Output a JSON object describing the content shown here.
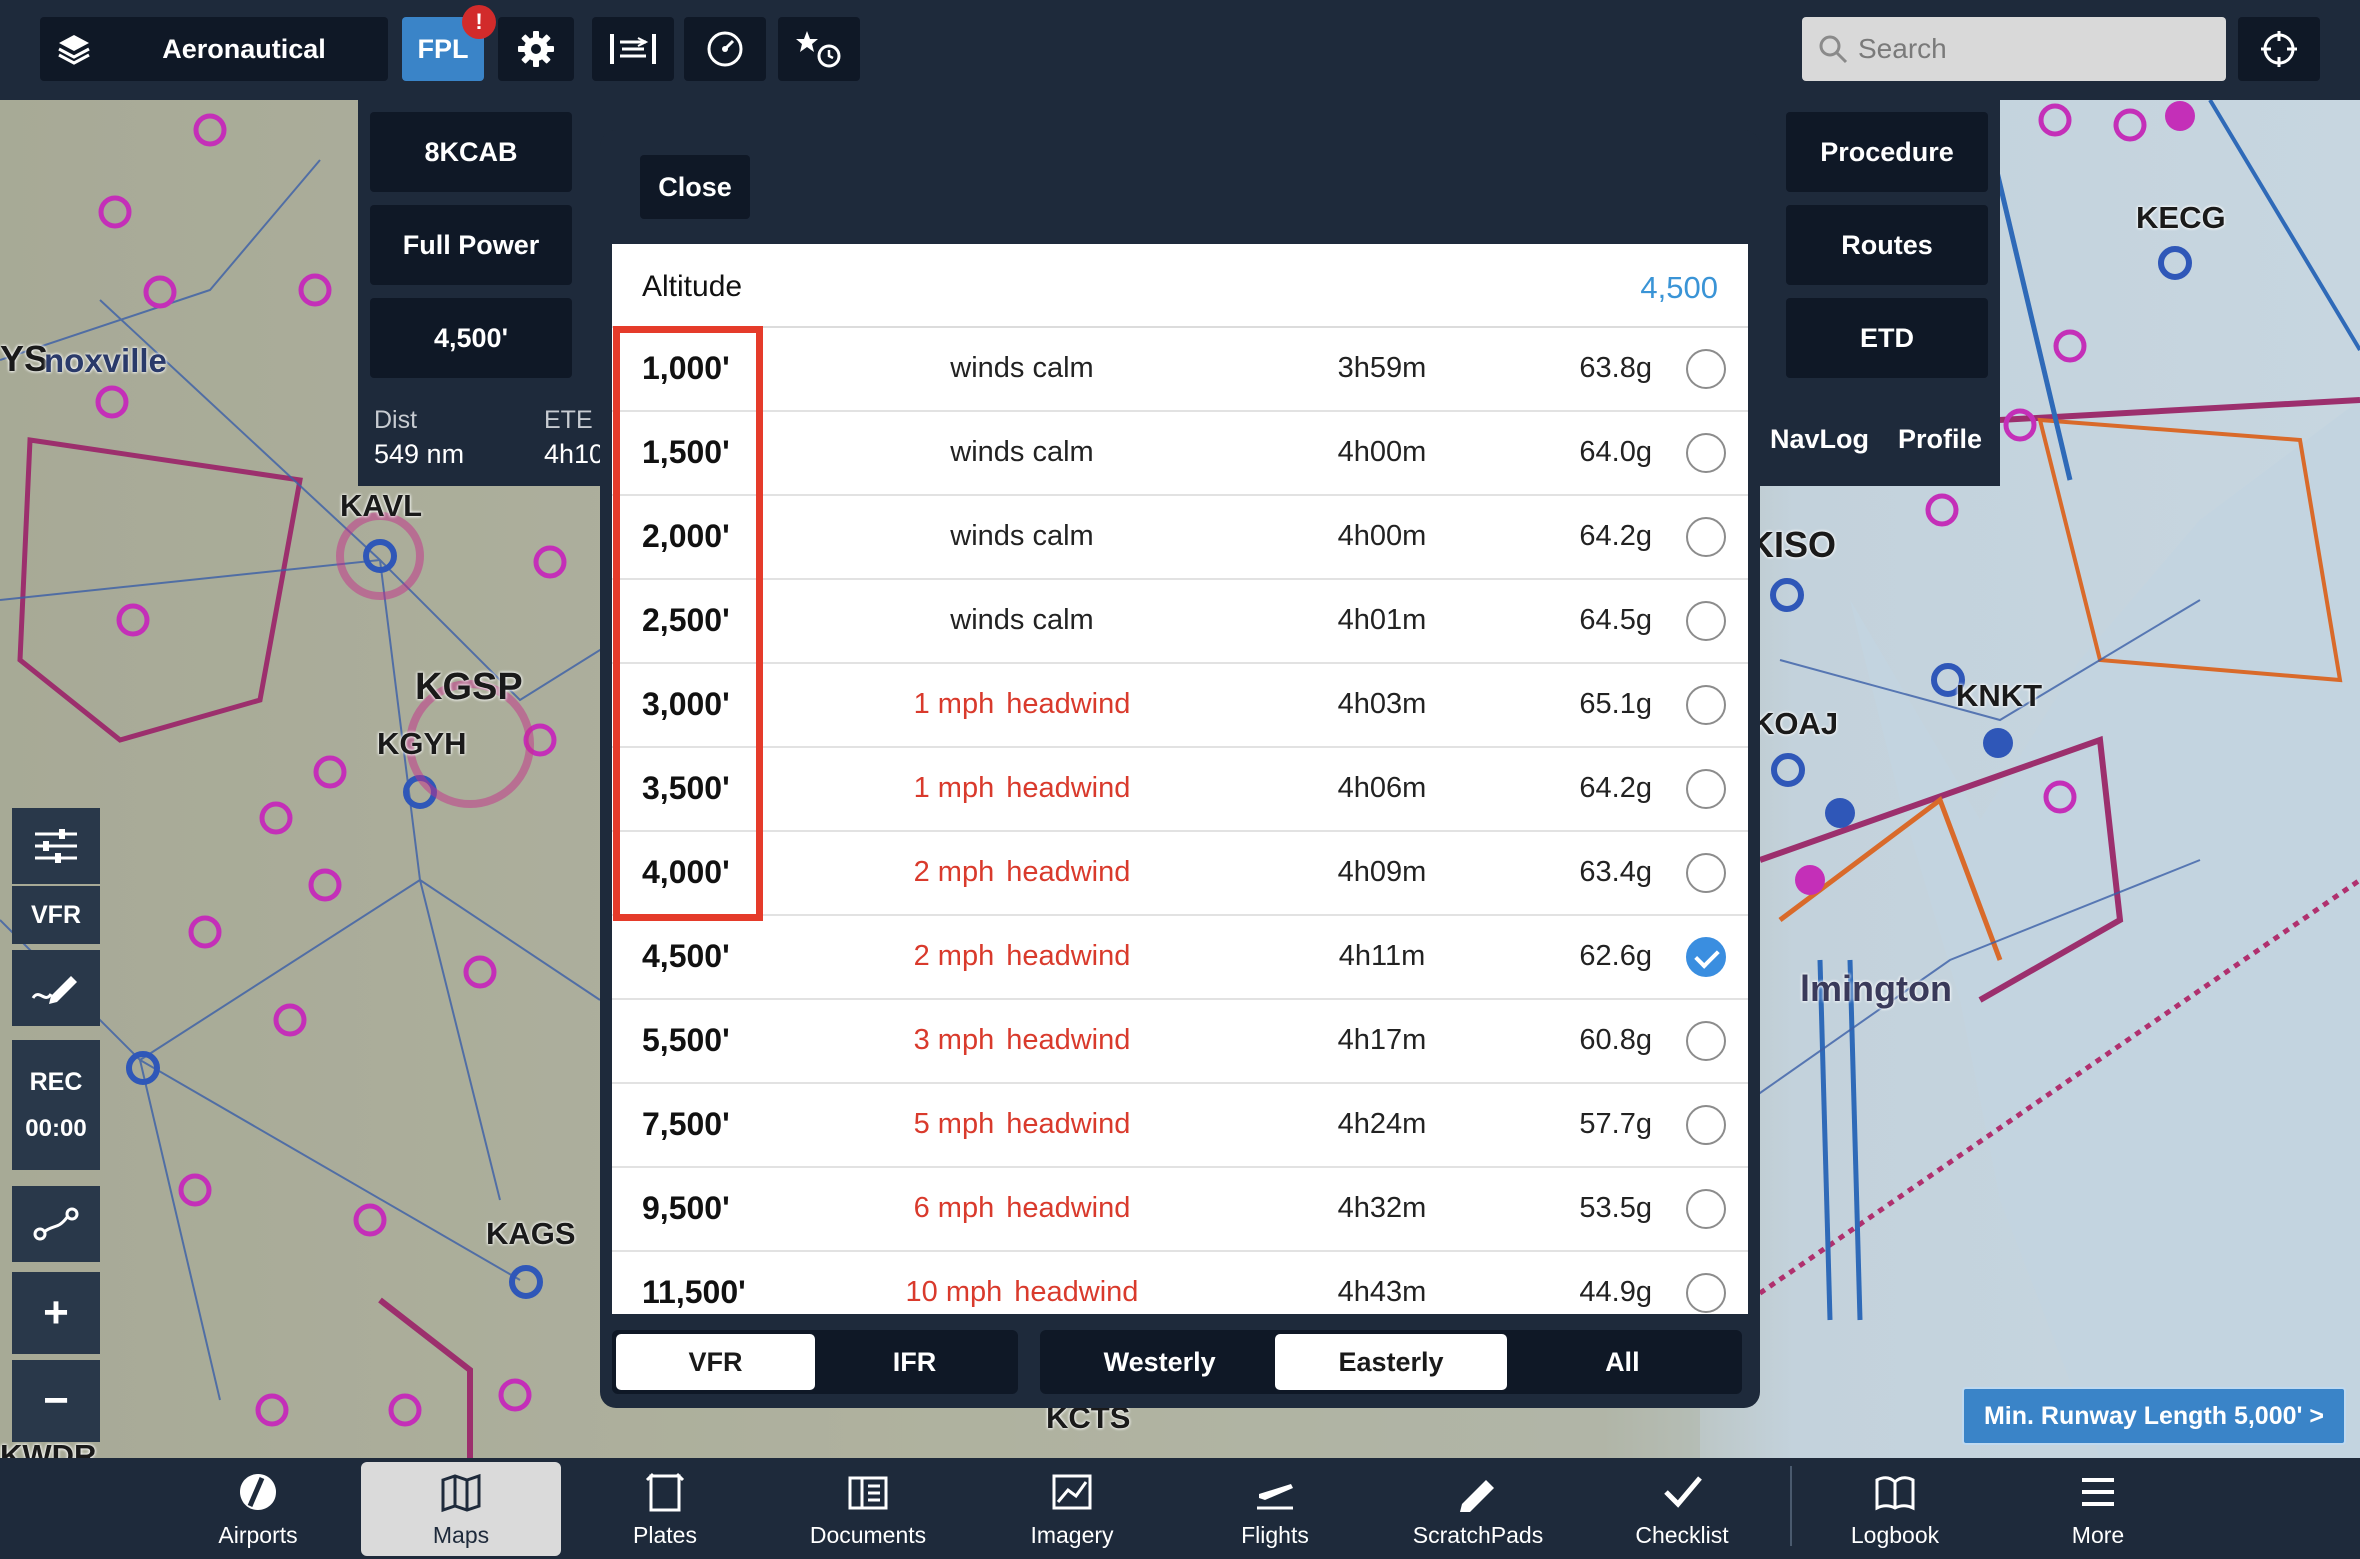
{
  "topbar": {
    "layer_label": "Aeronautical",
    "fpl_label": "FPL",
    "fpl_badge": "!",
    "search_placeholder": "Search"
  },
  "flight_plan": {
    "left_buttons": [
      "8KCAB",
      "Full Power",
      "4,500'"
    ],
    "right_buttons": [
      "Procedure",
      "Routes",
      "ETD"
    ],
    "dist_label": "Dist",
    "dist_value": "549 nm",
    "ete_label": "ETE",
    "ete_value": "4h10",
    "tabs": [
      "NavLog",
      "Profile"
    ]
  },
  "map": {
    "labels": [
      "YS",
      "noxville",
      "KAVL",
      "KGSP",
      "KGYH",
      "KAGS",
      "KECG",
      "KISO",
      "KNKT",
      "KOAJ",
      "lmington",
      "KCTS",
      "KWDR"
    ],
    "tools": {
      "vfr": "VFR",
      "rec": "REC",
      "rec_time": "00:00",
      "plus": "+",
      "minus": "−"
    }
  },
  "modal": {
    "close_label": "Close",
    "altitude_label": "Altitude",
    "altitude_value": "4,500",
    "rows": [
      {
        "alt": "1,000'",
        "speed": "",
        "wind": "winds calm",
        "ete": "3h59m",
        "fuel": "63.8g",
        "selected": false
      },
      {
        "alt": "1,500'",
        "speed": "",
        "wind": "winds calm",
        "ete": "4h00m",
        "fuel": "64.0g",
        "selected": false
      },
      {
        "alt": "2,000'",
        "speed": "",
        "wind": "winds calm",
        "ete": "4h00m",
        "fuel": "64.2g",
        "selected": false
      },
      {
        "alt": "2,500'",
        "speed": "",
        "wind": "winds calm",
        "ete": "4h01m",
        "fuel": "64.5g",
        "selected": false
      },
      {
        "alt": "3,000'",
        "speed": "1 mph",
        "wind": "headwind",
        "ete": "4h03m",
        "fuel": "65.1g",
        "selected": false
      },
      {
        "alt": "3,500'",
        "speed": "1 mph",
        "wind": "headwind",
        "ete": "4h06m",
        "fuel": "64.2g",
        "selected": false
      },
      {
        "alt": "4,000'",
        "speed": "2 mph",
        "wind": "headwind",
        "ete": "4h09m",
        "fuel": "63.4g",
        "selected": false
      },
      {
        "alt": "4,500'",
        "speed": "2 mph",
        "wind": "headwind",
        "ete": "4h11m",
        "fuel": "62.6g",
        "selected": true
      },
      {
        "alt": "5,500'",
        "speed": "3 mph",
        "wind": "headwind",
        "ete": "4h17m",
        "fuel": "60.8g",
        "selected": false
      },
      {
        "alt": "7,500'",
        "speed": "5 mph",
        "wind": "headwind",
        "ete": "4h24m",
        "fuel": "57.7g",
        "selected": false
      },
      {
        "alt": "9,500'",
        "speed": "6 mph",
        "wind": "headwind",
        "ete": "4h32m",
        "fuel": "53.5g",
        "selected": false
      },
      {
        "alt": "11,500'",
        "speed": "10 mph",
        "wind": "headwind",
        "ete": "4h43m",
        "fuel": "44.9g",
        "selected": false
      }
    ],
    "rules_options": [
      {
        "label": "VFR",
        "selected": true
      },
      {
        "label": "IFR",
        "selected": false
      }
    ],
    "direction_options": [
      {
        "label": "Westerly",
        "selected": false
      },
      {
        "label": "Easterly",
        "selected": true
      },
      {
        "label": "All",
        "selected": false
      }
    ]
  },
  "runway_banner": "Min. Runway Length 5,000' >",
  "tabs": [
    {
      "label": "Airports",
      "icon": "airports-icon",
      "selected": false
    },
    {
      "label": "Maps",
      "icon": "maps-icon",
      "selected": true
    },
    {
      "label": "Plates",
      "icon": "plates-icon",
      "selected": false
    },
    {
      "label": "Documents",
      "icon": "documents-icon",
      "selected": false
    },
    {
      "label": "Imagery",
      "icon": "imagery-icon",
      "selected": false
    },
    {
      "label": "Flights",
      "icon": "flights-icon",
      "selected": false
    },
    {
      "label": "ScratchPads",
      "icon": "scratchpads-icon",
      "selected": false
    },
    {
      "label": "Checklist",
      "icon": "checklist-icon",
      "selected": false
    },
    {
      "label": "Logbook",
      "icon": "logbook-icon",
      "selected": false
    },
    {
      "label": "More",
      "icon": "more-icon",
      "selected": false
    }
  ],
  "colors": {
    "chrome": "#1e2a3b",
    "accent": "#3a84c8",
    "headwind": "#d93a2c",
    "highlight": "#e53b2a",
    "altitude_value": "#3a94d6"
  }
}
